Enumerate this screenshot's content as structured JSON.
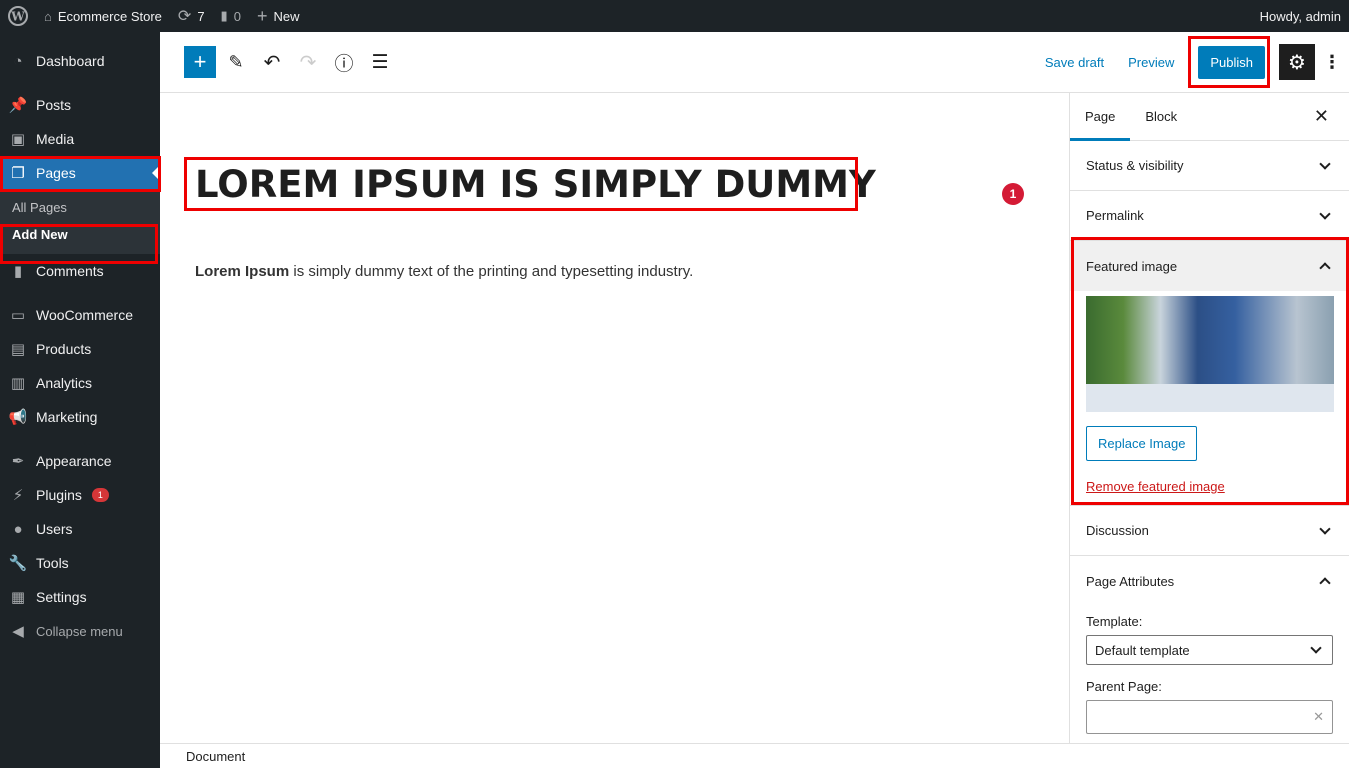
{
  "adminbar": {
    "site": "Ecommerce Store",
    "updates": "7",
    "comments": "0",
    "new": "New",
    "howdy": "Howdy, admin"
  },
  "sidebar": {
    "items": [
      {
        "label": "Dashboard",
        "icon": "dashboard-icon"
      },
      {
        "label": "Posts",
        "icon": "pin-icon"
      },
      {
        "label": "Media",
        "icon": "media-icon"
      },
      {
        "label": "Pages",
        "icon": "pages-icon"
      },
      {
        "label": "Comments",
        "icon": "comment-icon"
      },
      {
        "label": "WooCommerce",
        "icon": "woo-icon"
      },
      {
        "label": "Products",
        "icon": "archive-icon"
      },
      {
        "label": "Analytics",
        "icon": "chart-icon"
      },
      {
        "label": "Marketing",
        "icon": "megaphone-icon"
      },
      {
        "label": "Appearance",
        "icon": "brush-icon"
      },
      {
        "label": "Plugins",
        "icon": "plugin-icon",
        "badge": "1"
      },
      {
        "label": "Users",
        "icon": "user-icon"
      },
      {
        "label": "Tools",
        "icon": "wrench-icon"
      },
      {
        "label": "Settings",
        "icon": "settings-icon"
      },
      {
        "label": "Collapse menu",
        "icon": "collapse-icon"
      }
    ],
    "sub": [
      "All Pages",
      "Add New"
    ]
  },
  "toolbar": {
    "save_draft": "Save draft",
    "preview": "Preview",
    "publish": "Publish"
  },
  "editor": {
    "title": "LOREM IPSUM IS SIMPLY DUMMY",
    "para_bold": "Lorem Ipsum",
    "para_rest": " is simply dummy text of the printing and typesetting industry.",
    "notice": "1"
  },
  "panel": {
    "tabs": [
      "Page",
      "Block"
    ],
    "status": "Status & visibility",
    "permalink": "Permalink",
    "featured": "Featured image",
    "replace": "Replace Image",
    "remove": "Remove featured image",
    "discussion": "Discussion",
    "attributes": "Page Attributes",
    "template_label": "Template:",
    "template_value": "Default template",
    "parent_label": "Parent Page:"
  },
  "footer": {
    "breadcrumb": "Document"
  },
  "colors": {
    "accent": "#007cba",
    "admin_bg": "#1d2327",
    "active": "#2271b1",
    "highlight": "#ee0000"
  }
}
